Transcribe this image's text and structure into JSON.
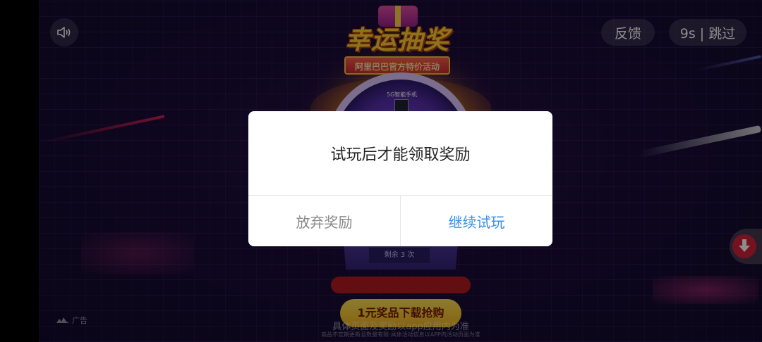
{
  "top_bar": {
    "mute_icon": "speaker-icon",
    "feedback_label": "反馈",
    "skip_label": "9s | 跳过"
  },
  "ad": {
    "logo_title": "幸运抽奖",
    "logo_subtitle": "阿里巴巴官方特价活动",
    "prize_label": "5G智能手机",
    "remaining_label": "剩余 3 次",
    "cta_label": "1元奖品下载抢购",
    "disclaimer": "具体页面及奖励以app应用内为准",
    "fine_print": "商品不定期更新且数量有限·具体活动信息以APP内活动页面为准",
    "ad_tag": "广告",
    "download_icon": "download-arrow-icon"
  },
  "dialog": {
    "message": "试玩后才能领取奖励",
    "give_up_label": "放弃奖励",
    "continue_label": "继续试玩"
  },
  "colors": {
    "accent": "#3a8ee6",
    "cta_yellow": "#f3b419",
    "download_red": "#d6223b"
  }
}
